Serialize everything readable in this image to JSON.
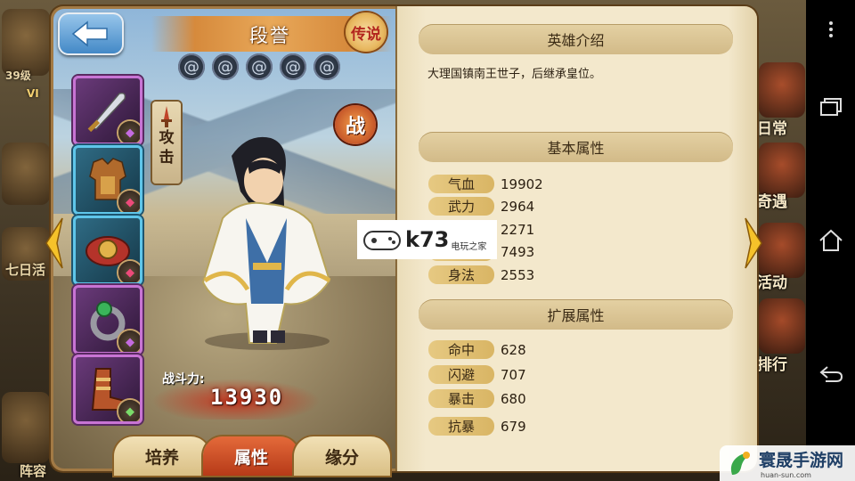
{
  "hero": {
    "name": "段誉",
    "rarity_badge": "传说",
    "role_tag": "攻击",
    "battle_badge": "战",
    "power_label": "战斗力:",
    "power_value": "13930"
  },
  "tabs": [
    {
      "label": "培养",
      "active": false
    },
    {
      "label": "属性",
      "active": true
    },
    {
      "label": "缘分",
      "active": false
    }
  ],
  "intro": {
    "header": "英雄介绍",
    "text": "大理国镇南王世子，后继承皇位。"
  },
  "basic": {
    "header": "基本属性",
    "stats": [
      {
        "label": "气血",
        "value": "19902"
      },
      {
        "label": "武力",
        "value": "2964"
      },
      {
        "label": "",
        "value": "2271"
      },
      {
        "label": "",
        "value": "7493"
      },
      {
        "label": "身法",
        "value": "2553"
      }
    ]
  },
  "extended": {
    "header": "扩展属性",
    "stats": [
      {
        "label": "命中",
        "value": "628"
      },
      {
        "label": "闪避",
        "value": "707"
      },
      {
        "label": "暴击",
        "value": "680"
      },
      {
        "label": "抗暴",
        "value": "679"
      }
    ]
  },
  "background": {
    "level_badge": "39级",
    "vip": "VI",
    "left_labels": [
      "七日活",
      "阵容"
    ],
    "right_labels": [
      "日常",
      "奇遇",
      "活动",
      "排行"
    ]
  },
  "watermark": {
    "k73": "k73",
    "k73_sub": "电玩之家",
    "corner": "寰晟手游网",
    "corner_sub": "huan-sun.com"
  },
  "colors": {
    "accent": "#e46a3a",
    "panel": "#f3e8cc",
    "stat_pill": "#e0bf72"
  }
}
